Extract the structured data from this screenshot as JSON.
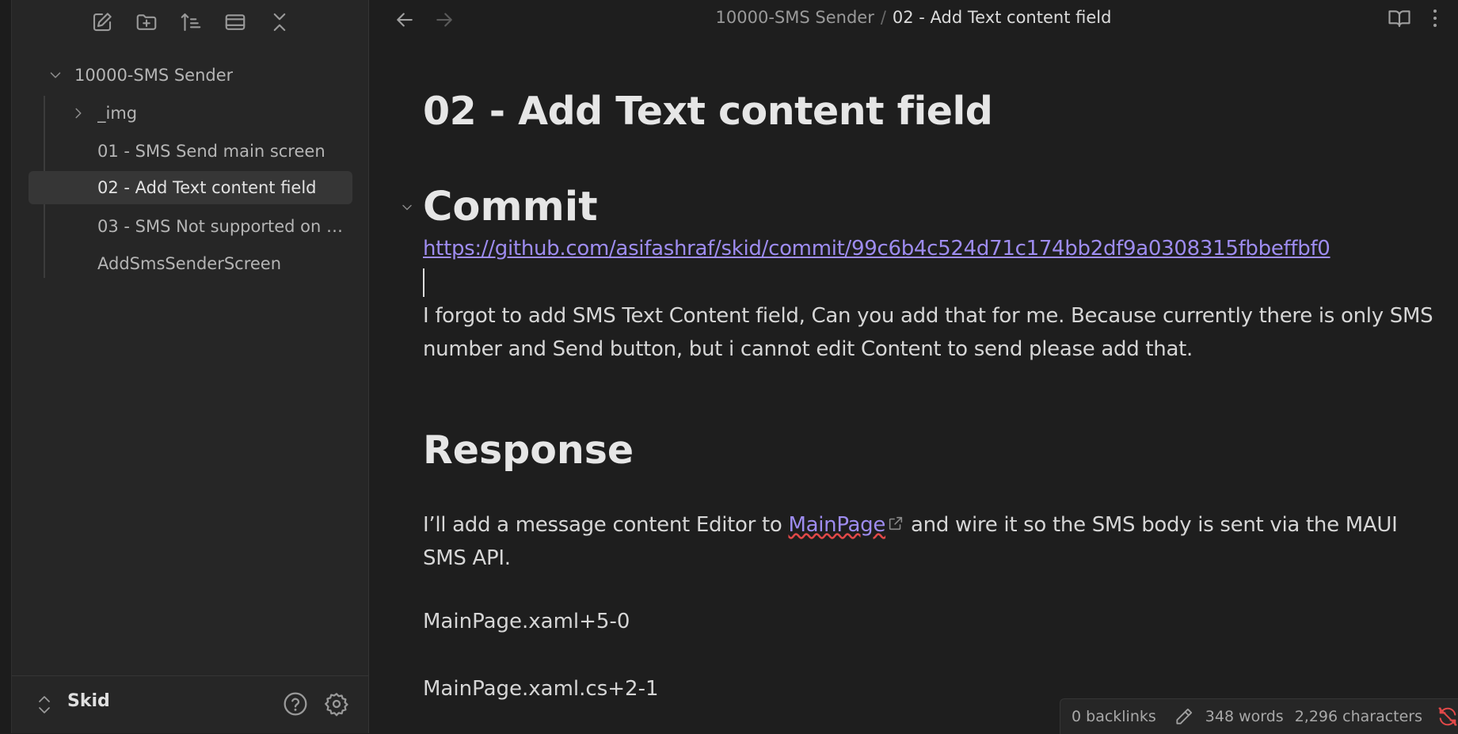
{
  "sidebar": {
    "toolbar": [
      {
        "name": "new-note-icon"
      },
      {
        "name": "new-folder-icon"
      },
      {
        "name": "sort-icon"
      },
      {
        "name": "auto-reveal-icon"
      },
      {
        "name": "collapse-all-icon"
      }
    ],
    "tree": {
      "folder": "10000-SMS Sender",
      "items": [
        {
          "label": "_img",
          "type": "folder"
        },
        {
          "label": "01 - SMS Send main screen",
          "type": "file"
        },
        {
          "label": "02 - Add Text content field",
          "type": "file",
          "active": true
        },
        {
          "label": "03 - SMS Not supported on d...",
          "type": "file"
        },
        {
          "label": "AddSmsSenderScreen",
          "type": "file"
        }
      ]
    },
    "vault_name": "Skid"
  },
  "header": {
    "breadcrumb_parent": "10000-SMS Sender",
    "breadcrumb_separator": "/",
    "breadcrumb_current": "02 - Add Text content field"
  },
  "document": {
    "title": "02 - Add Text content field",
    "h_commit": "Commit",
    "commit_link": "https://github.com/asifashraf/skid/commit/99c6b4c524d71c174bb2df9a0308315fbbeffbf0",
    "prompt_text": "I forgot to add SMS Text Content field, Can you add that for me. Because currently there is only SMS number and Send button, but i cannot edit Content to send please add that.",
    "h_response": "Response",
    "response_before": "I’ll add a message content Editor to ",
    "response_link": "MainPage",
    "response_after": " and wire it so the SMS body is sent via the MAUI SMS API.",
    "file_1": "MainPage.xaml+5-0",
    "file_2": "MainPage.xaml.cs+2-1"
  },
  "status": {
    "backlinks": "0 backlinks",
    "words": "348 words",
    "characters": "2,296 characters"
  },
  "colors": {
    "accent_link": "#9e8cf0",
    "sync_error": "#e04848",
    "background": "#1e1e1e",
    "sidebar_bg": "#262626"
  }
}
